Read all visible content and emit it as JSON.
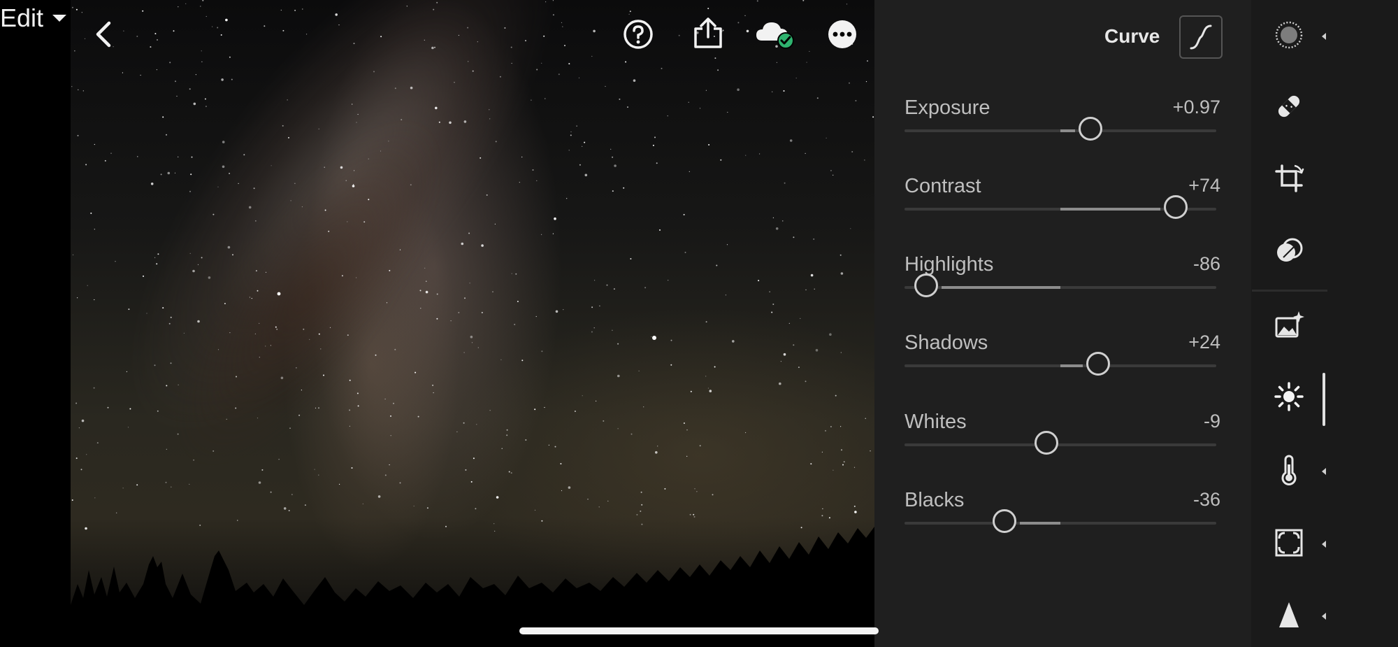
{
  "toolbar": {
    "edit_label": "Edit",
    "icons": [
      "back-chevron-icon",
      "help-icon",
      "share-icon",
      "cloud-synced-icon",
      "more-icon"
    ]
  },
  "panel": {
    "curve_label": "Curve",
    "adjustments": [
      {
        "name": "Exposure",
        "value": "+0.97",
        "level": 0.97,
        "min": -5,
        "max": 5
      },
      {
        "name": "Contrast",
        "value": "+74",
        "level": 74,
        "min": -100,
        "max": 100
      },
      {
        "name": "Highlights",
        "value": "-86",
        "level": -86,
        "min": -100,
        "max": 100
      },
      {
        "name": "Shadows",
        "value": "+24",
        "level": 24,
        "min": -100,
        "max": 100
      },
      {
        "name": "Whites",
        "value": "-9",
        "level": -9,
        "min": -100,
        "max": 100
      },
      {
        "name": "Blacks",
        "value": "-36",
        "level": -36,
        "min": -100,
        "max": 100
      }
    ]
  },
  "tools": [
    {
      "icon": "presets-icon",
      "caret": true
    },
    {
      "icon": "healing-bandage-icon",
      "caret": false
    },
    {
      "icon": "crop-icon",
      "caret": false
    },
    {
      "icon": "masking-icon",
      "caret": false
    },
    {
      "icon": "auto-enhance-icon",
      "caret": false
    },
    {
      "icon": "light-icon",
      "caret": false,
      "active": true
    },
    {
      "icon": "color-temperature-icon",
      "caret": true
    },
    {
      "icon": "effects-vignette-icon",
      "caret": true
    },
    {
      "icon": "detail-icon",
      "caret": true
    }
  ],
  "colors": {
    "panel_bg": "#1f1f1f",
    "tool_bg": "#1a1a1a",
    "accent_check": "#2fb36f"
  }
}
